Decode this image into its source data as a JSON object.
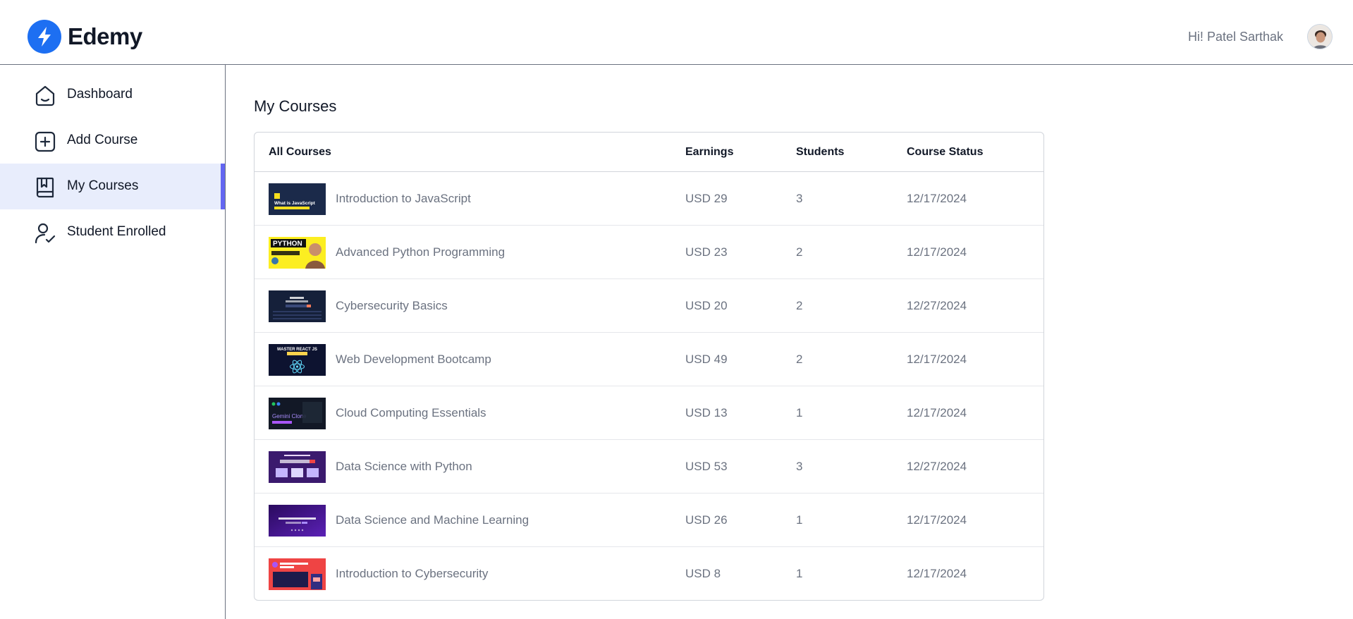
{
  "app": {
    "brand": "Edemy",
    "greeting": "Hi! Patel Sarthak",
    "accent": "#1d6ff2",
    "active_indicator": "#6366f1"
  },
  "sidebar": {
    "items": [
      {
        "label": "Dashboard",
        "icon": "home-icon",
        "active": false
      },
      {
        "label": "Add Course",
        "icon": "add-square-icon",
        "active": false
      },
      {
        "label": "My Courses",
        "icon": "bookmark-book-icon",
        "active": true
      },
      {
        "label": "Student Enrolled",
        "icon": "user-check-icon",
        "active": false
      }
    ]
  },
  "main": {
    "title": "My Courses",
    "table": {
      "headers": [
        "All Courses",
        "Earnings",
        "Students",
        "Course Status"
      ],
      "rows": [
        {
          "title": "Introduction to JavaScript",
          "earnings": "USD 29",
          "students": "3",
          "status": "12/17/2024",
          "thumb_text": "What is JavaScript"
        },
        {
          "title": "Advanced Python Programming",
          "earnings": "USD 23",
          "students": "2",
          "status": "12/17/2024",
          "thumb_text": "PYTHON"
        },
        {
          "title": "Cybersecurity Basics",
          "earnings": "USD 20",
          "students": "2",
          "status": "12/27/2024",
          "thumb_text": ""
        },
        {
          "title": "Web Development Bootcamp",
          "earnings": "USD 49",
          "students": "2",
          "status": "12/17/2024",
          "thumb_text": "MASTER REACT JS"
        },
        {
          "title": "Cloud Computing Essentials",
          "earnings": "USD 13",
          "students": "1",
          "status": "12/17/2024",
          "thumb_text": "Gemini Clone"
        },
        {
          "title": "Data Science with Python",
          "earnings": "USD 53",
          "students": "3",
          "status": "12/27/2024",
          "thumb_text": ""
        },
        {
          "title": "Data Science and Machine Learning",
          "earnings": "USD 26",
          "students": "1",
          "status": "12/17/2024",
          "thumb_text": ""
        },
        {
          "title": "Introduction to Cybersecurity",
          "earnings": "USD 8",
          "students": "1",
          "status": "12/17/2024",
          "thumb_text": ""
        }
      ]
    }
  }
}
